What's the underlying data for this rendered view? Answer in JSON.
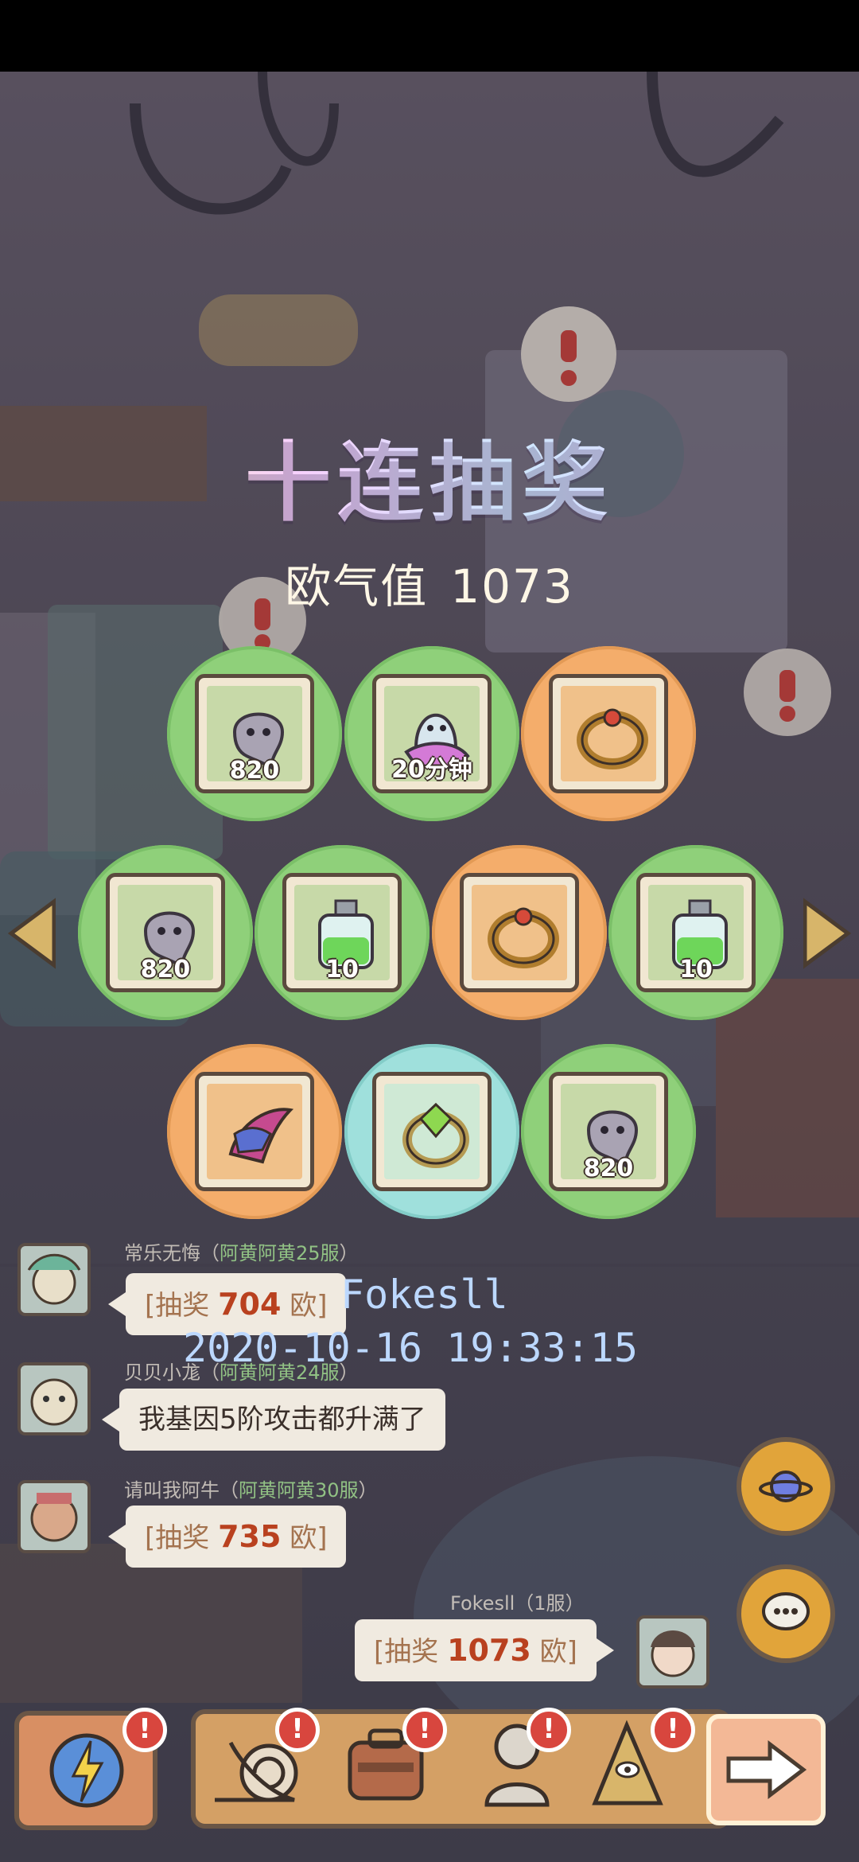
{
  "title": "十连抽奖",
  "luck": {
    "label": "欧气值",
    "value": "1073"
  },
  "prizes": [
    {
      "qty": "820",
      "item": "ghost-blob",
      "bg": "green"
    },
    {
      "qty": "20分钟",
      "item": "ghost-sheet",
      "bg": "green"
    },
    {
      "qty": "",
      "item": "ring",
      "bg": "orange"
    },
    {
      "qty": "820",
      "item": "ghost-blob",
      "bg": "green"
    },
    {
      "qty": "10",
      "item": "potion",
      "bg": "green"
    },
    {
      "qty": "",
      "item": "ring",
      "bg": "orange"
    },
    {
      "qty": "10",
      "item": "potion",
      "bg": "green"
    },
    {
      "qty": "",
      "item": "wing",
      "bg": "orange"
    },
    {
      "qty": "",
      "item": "gem-ring",
      "bg": "teal"
    },
    {
      "qty": "820",
      "item": "ghost-blob",
      "bg": "green"
    }
  ],
  "chat": [
    {
      "name": "常乐无悔",
      "server": "阿黄阿黄25服",
      "prefix": "[抽奖 ",
      "amount": "704",
      "suffix": " 欧]"
    },
    {
      "name": "贝贝小尨",
      "server": "阿黄阿黄24服",
      "text": "我基因5阶攻击都升满了"
    },
    {
      "name": "请叫我阿牛",
      "server": "阿黄阿黄30服",
      "prefix": "[抽奖 ",
      "amount": "735",
      "suffix": " 欧]"
    },
    {
      "name": "Fokesll",
      "server": "1服",
      "prefix": "[抽奖 ",
      "amount": "1073",
      "suffix": " 欧]"
    }
  ],
  "watermark": {
    "user": "Fokesll",
    "time": "2020-10-16 19:33:15"
  },
  "badges": {
    "mark": "!"
  },
  "colors": {
    "green": "#8fd07a",
    "orange": "#f4ad6b",
    "teal": "#9fe0dc",
    "badge": "#d8463e"
  }
}
